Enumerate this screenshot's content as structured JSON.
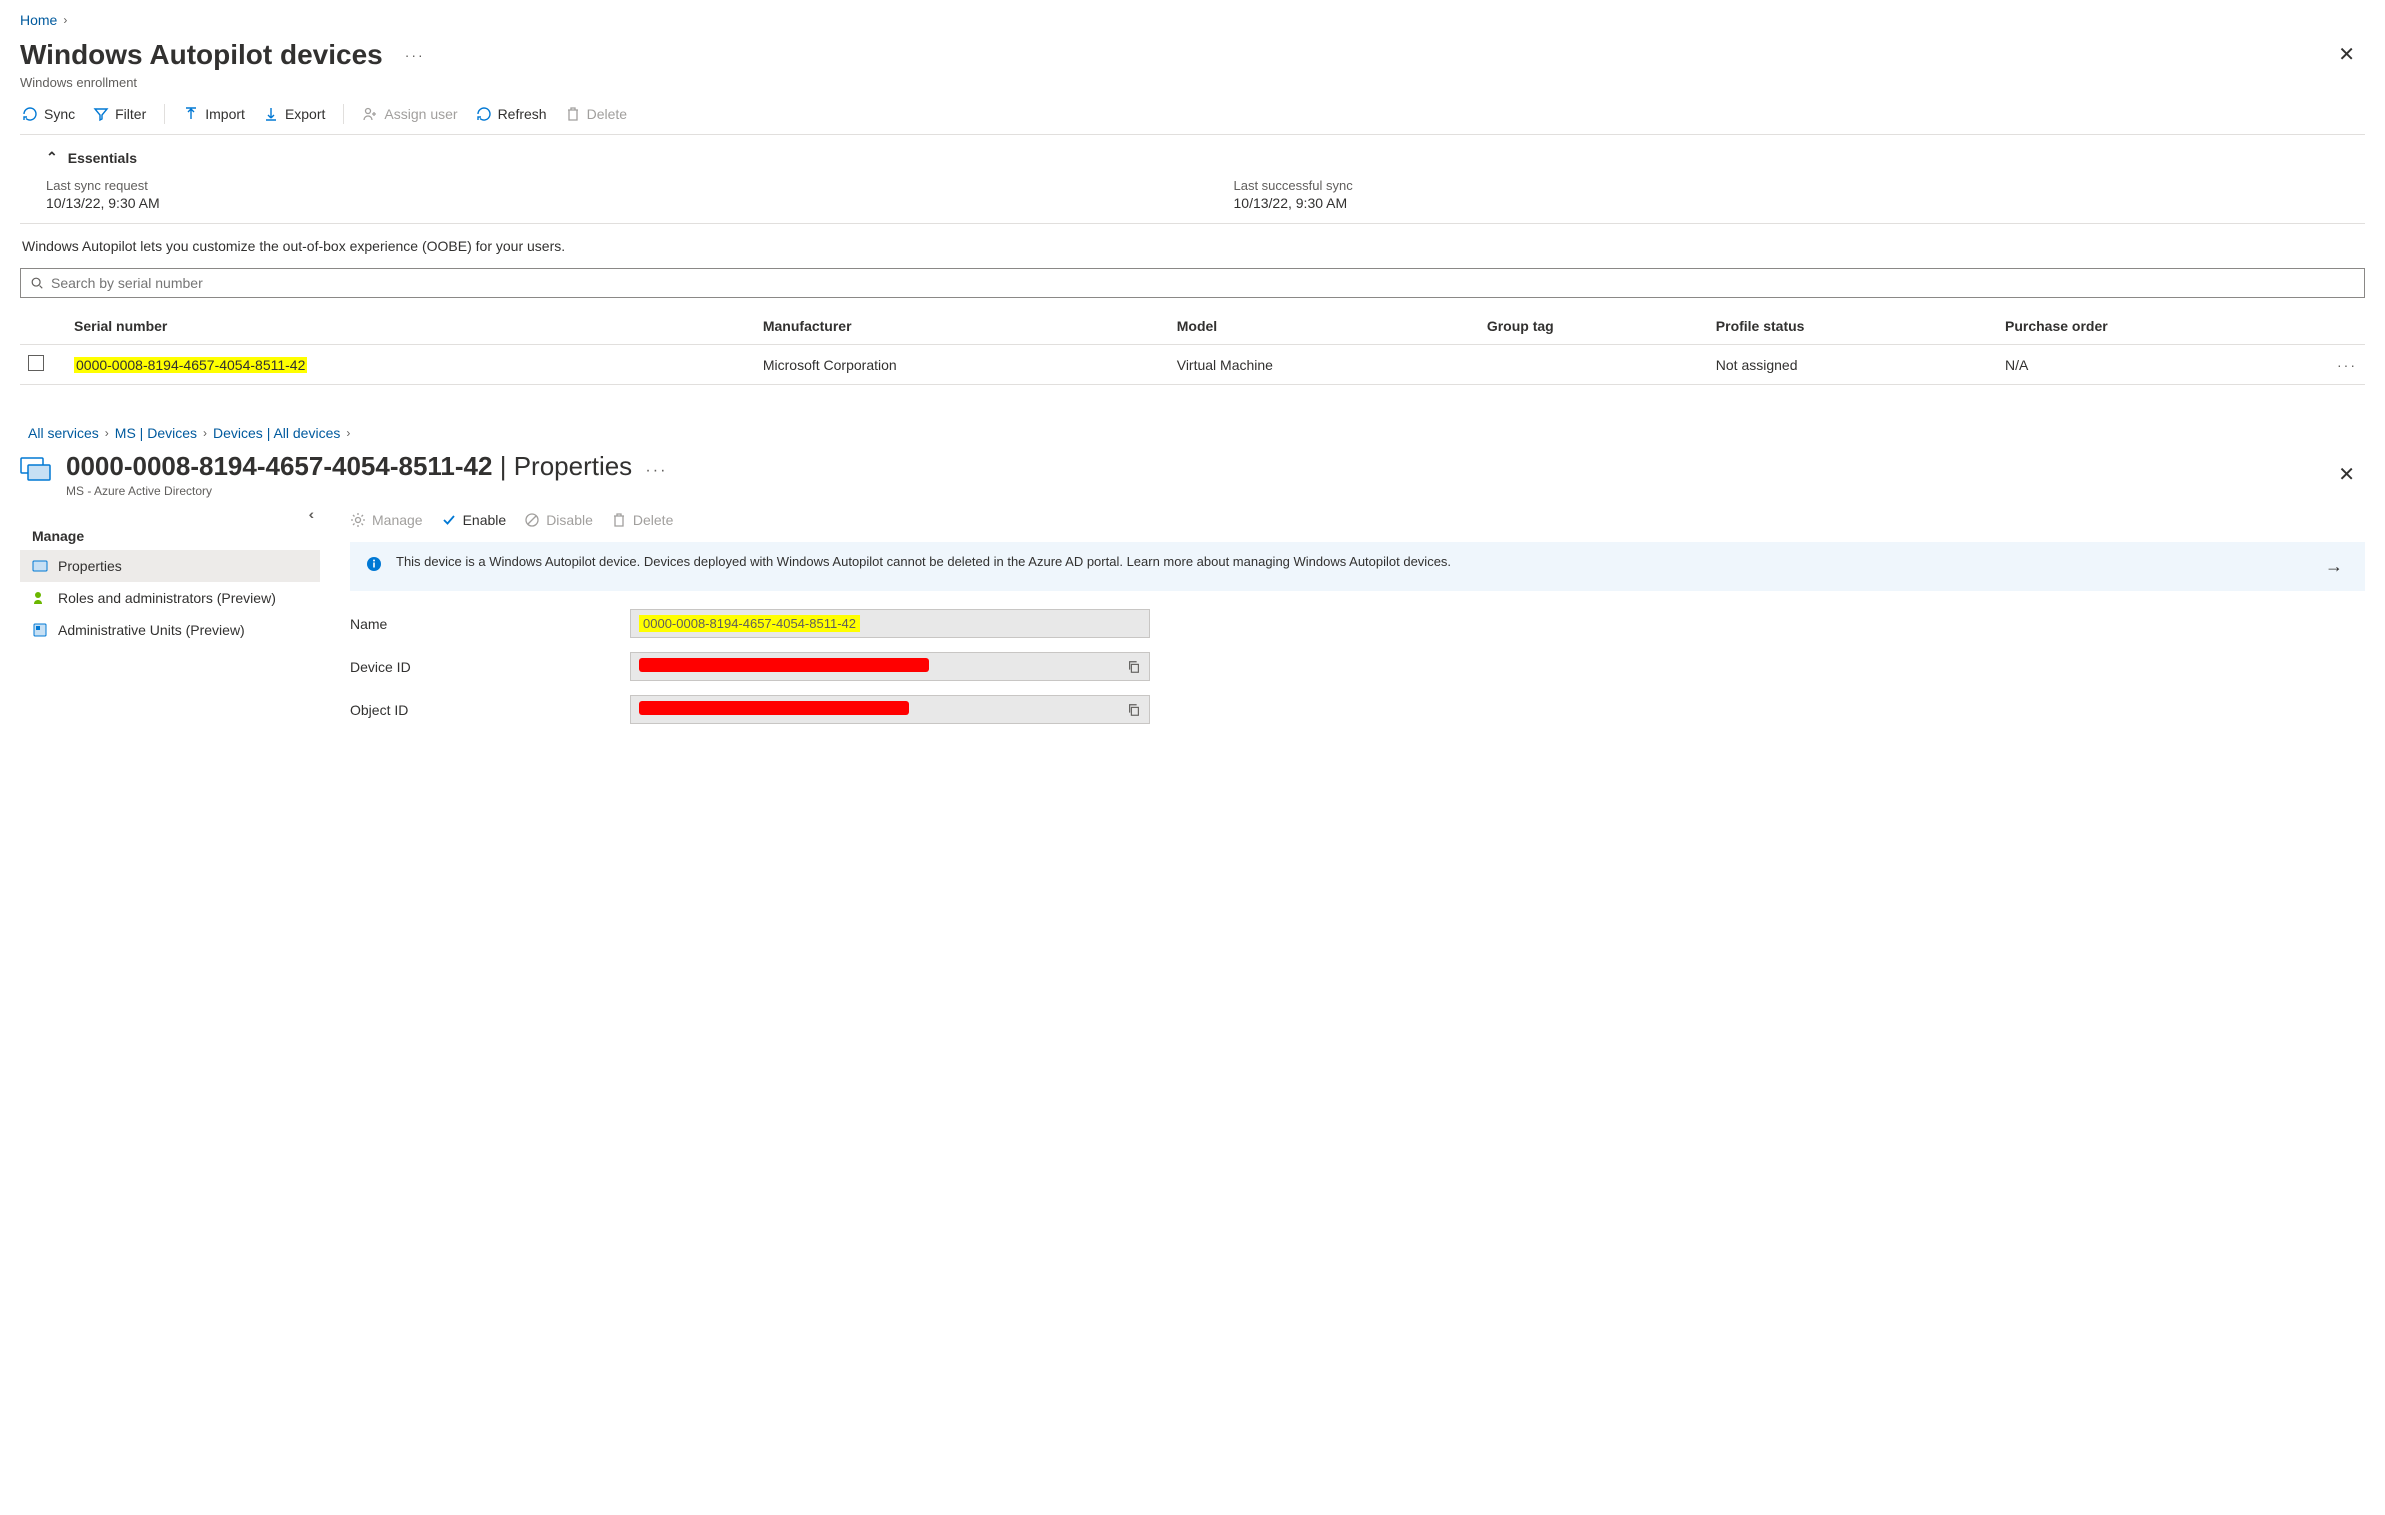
{
  "breadcrumb1": {
    "home": "Home"
  },
  "page1": {
    "title": "Windows Autopilot devices",
    "subtitle": "Windows enrollment"
  },
  "toolbar1": {
    "sync": "Sync",
    "filter": "Filter",
    "import": "Import",
    "export": "Export",
    "assign_user": "Assign user",
    "refresh": "Refresh",
    "delete": "Delete"
  },
  "essentials": {
    "header": "Essentials",
    "last_sync_request_label": "Last sync request",
    "last_sync_request_value": "10/13/22, 9:30 AM",
    "last_success_label": "Last successful sync",
    "last_success_value": "10/13/22, 9:30 AM"
  },
  "description": "Windows Autopilot lets you customize the out-of-box experience (OOBE) for your users.",
  "search": {
    "placeholder": "Search by serial number"
  },
  "table": {
    "headers": {
      "serial": "Serial number",
      "manufacturer": "Manufacturer",
      "model": "Model",
      "group_tag": "Group tag",
      "profile_status": "Profile status",
      "purchase_order": "Purchase order"
    },
    "row": {
      "serial": "0000-0008-8194-4657-4054-8511-42",
      "manufacturer": "Microsoft Corporation",
      "model": "Virtual Machine",
      "group_tag": "",
      "profile_status": "Not assigned",
      "purchase_order": "N/A"
    }
  },
  "breadcrumb2": {
    "all_services": "All services",
    "ms_devices": "MS | Devices",
    "devices_all": "Devices | All devices"
  },
  "page2": {
    "title_id": "0000-0008-8194-4657-4054-8511-42",
    "title_sep": " | ",
    "title_section": "Properties",
    "subtitle": "MS - Azure Active Directory"
  },
  "side": {
    "header": "Manage",
    "properties": "Properties",
    "roles": "Roles and administrators (Preview)",
    "admin_units": "Administrative Units (Preview)"
  },
  "toolbar2": {
    "manage": "Manage",
    "enable": "Enable",
    "disable": "Disable",
    "delete": "Delete"
  },
  "banner": "This device is a Windows Autopilot device. Devices deployed with Windows Autopilot cannot be deleted in the Azure AD portal. Learn more about managing Windows Autopilot devices.",
  "props": {
    "name_label": "Name",
    "name_value": "0000-0008-8194-4657-4054-8511-42",
    "device_id_label": "Device ID",
    "object_id_label": "Object ID"
  }
}
